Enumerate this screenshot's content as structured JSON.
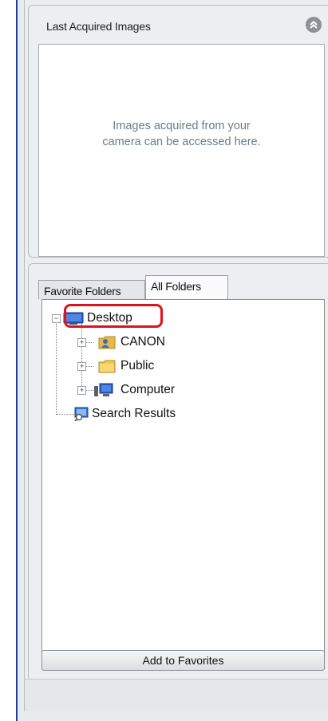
{
  "last_acquired": {
    "title": "Last Acquired Images",
    "collapse_icon": "double-chevron-up-icon",
    "placeholder_line1": "Images acquired from your",
    "placeholder_line2": "camera can be accessed here."
  },
  "tabs": [
    {
      "label": "Favorite Folders",
      "active": false
    },
    {
      "label": "All Folders",
      "active": true
    }
  ],
  "tree": [
    {
      "label": "Desktop",
      "icon": "desktop-icon",
      "expander": "-",
      "highlighted": true
    },
    {
      "label": "CANON",
      "icon": "user-folder-icon",
      "expander": "+"
    },
    {
      "label": "Public",
      "icon": "folder-icon",
      "expander": "+"
    },
    {
      "label": "Computer",
      "icon": "computer-icon",
      "expander": "+"
    },
    {
      "label": "Search Results",
      "icon": "search-results-icon",
      "expander": ""
    }
  ],
  "add_button": "Add to Favorites",
  "colors": {
    "highlight": "#e0101c",
    "accent": "#1b3f9c"
  }
}
